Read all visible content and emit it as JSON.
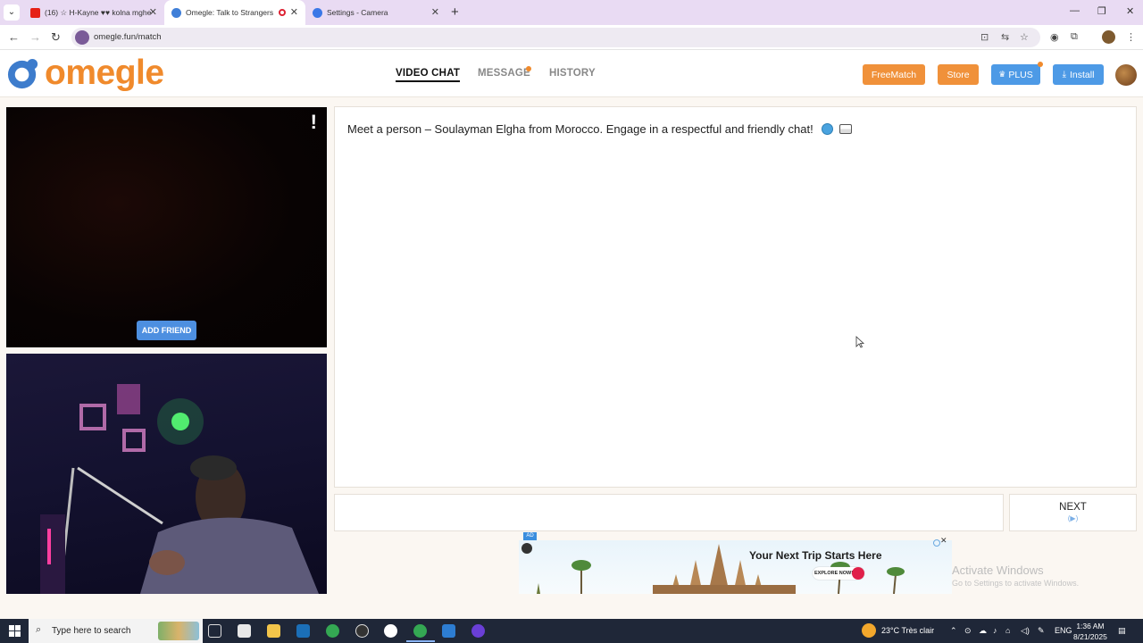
{
  "browser": {
    "tabs": [
      {
        "title": "(16) ☆ H-Kayne ♥♥ kolna mghe",
        "active": false
      },
      {
        "title": "Omegle: Talk to Strangers vi",
        "active": true
      },
      {
        "title": "Settings - Camera",
        "active": false
      }
    ],
    "url": "omegle.fun/match"
  },
  "site": {
    "logo_text": "omegle",
    "nav": [
      "VIDEO CHAT",
      "MESSAGE",
      "HISTORY"
    ],
    "buttons": {
      "freematch": "FreeMatch",
      "store": "Store",
      "plus": "PLUS",
      "install": "Install"
    },
    "accent_color": "#f08a2c",
    "blue_color": "#4d9ae6"
  },
  "video": {
    "remote_alert": "!",
    "add_friend_label": "ADD FRIEND"
  },
  "chat": {
    "message": "Meet a person – Soulayman Elgha from Morocco. Engage in a respectful and friendly chat!",
    "next_label": "NEXT",
    "next_hint": "(▶)"
  },
  "ad": {
    "tag": "AD",
    "headline": "Your Next Trip Starts Here",
    "cta": "EXPLORE NOW!"
  },
  "watermark": {
    "line1": "Activate Windows",
    "line2": "Go to Settings to activate Windows."
  },
  "taskbar": {
    "search_placeholder": "Type here to search",
    "weather": "23°C  Très clair",
    "lang": "ENG",
    "time": "1:36 AM",
    "date": "8/21/2025"
  }
}
